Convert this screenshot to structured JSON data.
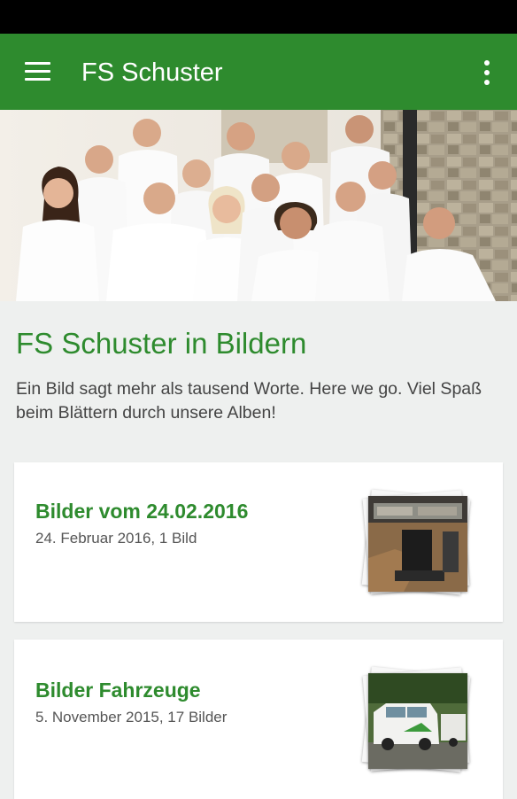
{
  "app_bar": {
    "title": "FS Schuster",
    "menu_icon": "hamburger-menu-icon",
    "overflow_icon": "more-vert-icon",
    "color": "#2e8b2e"
  },
  "intro": {
    "title": "FS Schuster in Bildern",
    "text": "Ein Bild sagt mehr als tausend Worte. Here we go. Viel Spaß beim Blättern durch unsere Alben!"
  },
  "albums": [
    {
      "title": "Bilder vom 24.02.2016",
      "subtitle": "24. Februar 2016, 1 Bild"
    },
    {
      "title": "Bilder Fahrzeuge",
      "subtitle": "5. November 2015, 17 Bilder"
    }
  ]
}
